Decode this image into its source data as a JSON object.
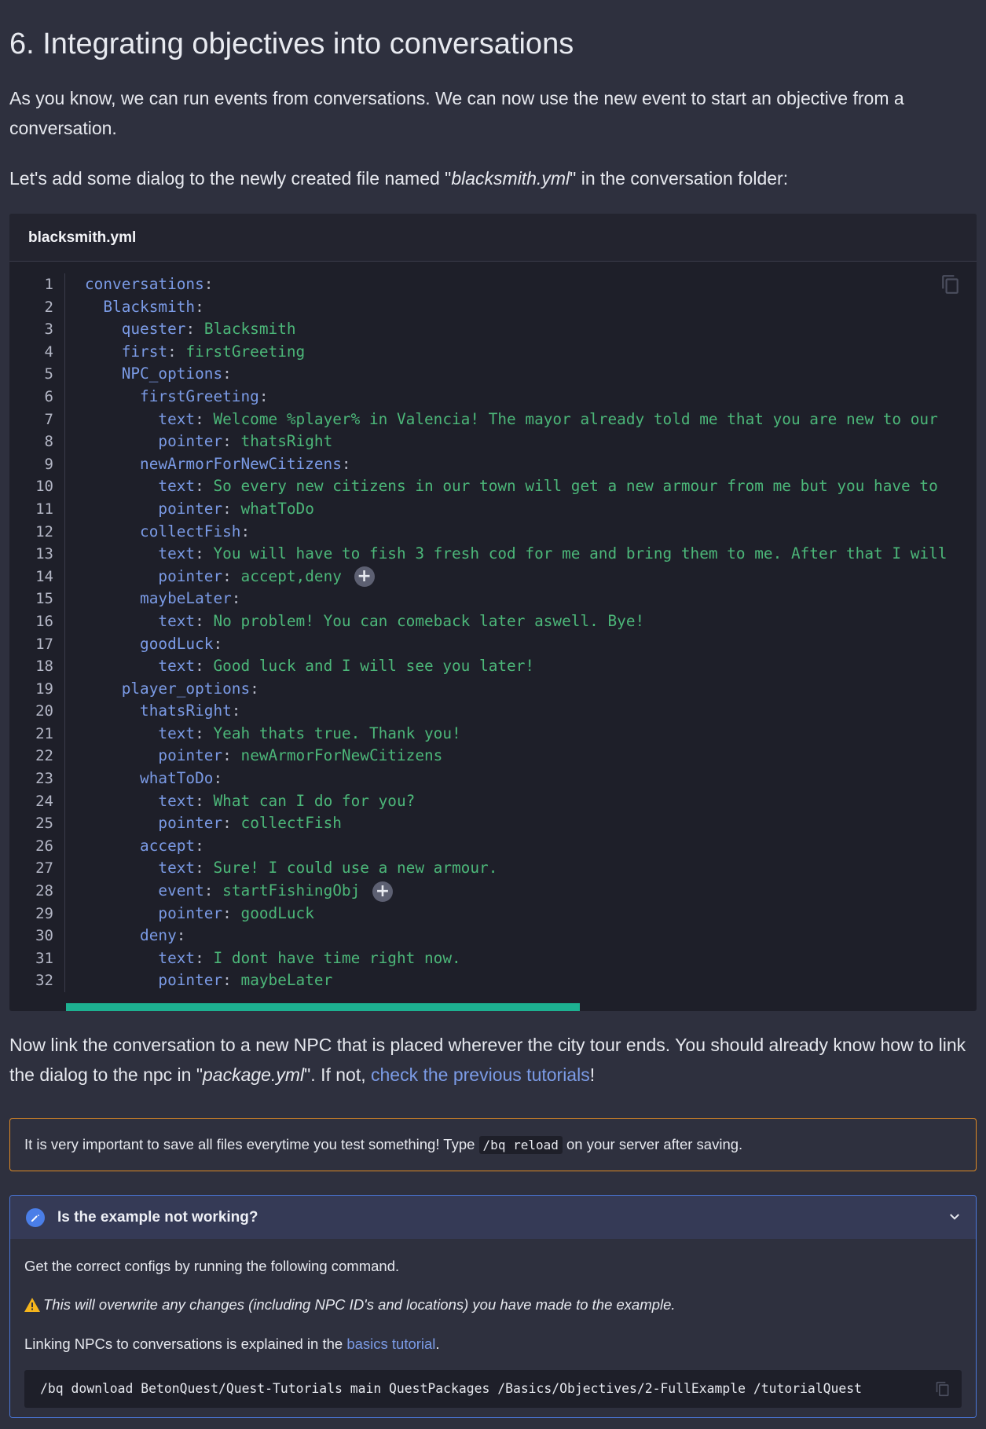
{
  "heading": "6. Integrating objectives into conversations",
  "intro": "As you know, we can run events from conversations. We can now use the new event to start an objective from a conversation.",
  "dialog_intro": {
    "before": "Let's add some dialog to the newly created file named \"",
    "filename": "blacksmith.yml",
    "after": "\" in the conversation folder:"
  },
  "code_block": {
    "title": "blacksmith.yml",
    "copy_icon": "copy-icon",
    "lines": [
      {
        "num": "1",
        "indent": "",
        "key": "conversations",
        "value": ""
      },
      {
        "num": "2",
        "indent": "  ",
        "key": "Blacksmith",
        "value": ""
      },
      {
        "num": "3",
        "indent": "    ",
        "key": "quester",
        "value": "Blacksmith"
      },
      {
        "num": "4",
        "indent": "    ",
        "key": "first",
        "value": "firstGreeting"
      },
      {
        "num": "5",
        "indent": "    ",
        "key": "NPC_options",
        "value": ""
      },
      {
        "num": "6",
        "indent": "      ",
        "key": "firstGreeting",
        "value": ""
      },
      {
        "num": "7",
        "indent": "        ",
        "key": "text",
        "value": "Welcome %player% in Valencia! The mayor already told me that you are new to our"
      },
      {
        "num": "8",
        "indent": "        ",
        "key": "pointer",
        "value": "thatsRight"
      },
      {
        "num": "9",
        "indent": "      ",
        "key": "newArmorForNewCitizens",
        "value": ""
      },
      {
        "num": "10",
        "indent": "        ",
        "key": "text",
        "value": "So every new citizens in our town will get a new armour from me but you have to"
      },
      {
        "num": "11",
        "indent": "        ",
        "key": "pointer",
        "value": "whatToDo"
      },
      {
        "num": "12",
        "indent": "      ",
        "key": "collectFish",
        "value": ""
      },
      {
        "num": "13",
        "indent": "        ",
        "key": "text",
        "value": "You will have to fish 3 fresh cod for me and bring them to me. After that I will"
      },
      {
        "num": "14",
        "indent": "        ",
        "key": "pointer",
        "value": "accept,deny",
        "annotation": true
      },
      {
        "num": "15",
        "indent": "      ",
        "key": "maybeLater",
        "value": ""
      },
      {
        "num": "16",
        "indent": "        ",
        "key": "text",
        "value": "No problem! You can comeback later aswell. Bye!"
      },
      {
        "num": "17",
        "indent": "      ",
        "key": "goodLuck",
        "value": ""
      },
      {
        "num": "18",
        "indent": "        ",
        "key": "text",
        "value": "Good luck and I will see you later!"
      },
      {
        "num": "19",
        "indent": "    ",
        "key": "player_options",
        "value": ""
      },
      {
        "num": "20",
        "indent": "      ",
        "key": "thatsRight",
        "value": ""
      },
      {
        "num": "21",
        "indent": "        ",
        "key": "text",
        "value": "Yeah thats true. Thank you!"
      },
      {
        "num": "22",
        "indent": "        ",
        "key": "pointer",
        "value": "newArmorForNewCitizens"
      },
      {
        "num": "23",
        "indent": "      ",
        "key": "whatToDo",
        "value": ""
      },
      {
        "num": "24",
        "indent": "        ",
        "key": "text",
        "value": "What can I do for you?"
      },
      {
        "num": "25",
        "indent": "        ",
        "key": "pointer",
        "value": "collectFish"
      },
      {
        "num": "26",
        "indent": "      ",
        "key": "accept",
        "value": ""
      },
      {
        "num": "27",
        "indent": "        ",
        "key": "text",
        "value": "Sure! I could use a new armour."
      },
      {
        "num": "28",
        "indent": "        ",
        "key": "event",
        "value": "startFishingObj",
        "annotation": true
      },
      {
        "num": "29",
        "indent": "        ",
        "key": "pointer",
        "value": "goodLuck"
      },
      {
        "num": "30",
        "indent": "      ",
        "key": "deny",
        "value": ""
      },
      {
        "num": "31",
        "indent": "        ",
        "key": "text",
        "value": "I dont have time right now."
      },
      {
        "num": "32",
        "indent": "        ",
        "key": "pointer",
        "value": "maybeLater"
      }
    ],
    "annotation_symbol": "+"
  },
  "link_paragraph": {
    "before": "Now link the conversation to a new NPC that is placed wherever the city tour ends. You should already know how to link the dialog to the npc in \"",
    "filename": "package.yml",
    "middle": "\". If not, ",
    "link": "check the previous tutorials",
    "after": "!"
  },
  "warning_box": {
    "before": "It is very important to save all files everytime you test something! Type ",
    "code": "/bq reload",
    "after": " on your server after saving."
  },
  "details": {
    "title": "Is the example not working?",
    "line1": "Get the correct configs by running the following command.",
    "warning_text": "This will overwrite any changes (including NPC ID's and locations) you have made to the example.",
    "line3_before": "Linking NPCs to conversations is explained in the ",
    "line3_link": "basics tutorial",
    "line3_after": ".",
    "command": "/bq download BetonQuest/Quest-Tutorials main QuestPackages /Basics/Objectives/2-FullExample /tutorialQuest"
  },
  "colors": {
    "background": "#2e303e",
    "code_background": "#1e1f29",
    "key": "#7b9be6",
    "value": "#4cb779",
    "link": "#7b9be6",
    "warning_border": "#e08a24",
    "details_border": "#4a77d9",
    "scrollbar": "#1db191"
  }
}
